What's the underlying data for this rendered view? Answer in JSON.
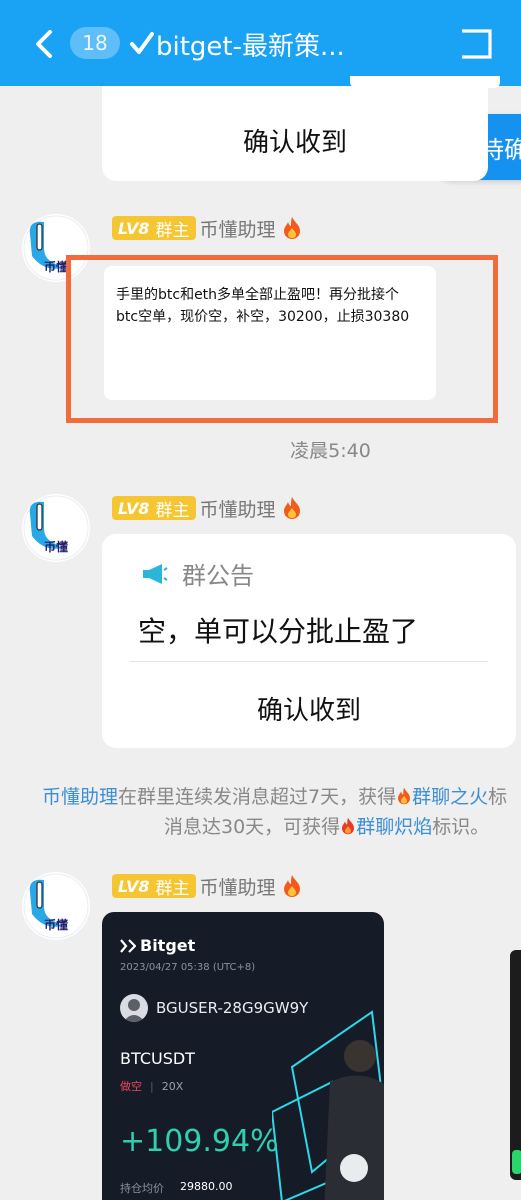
{
  "header": {
    "unread_count": "18",
    "title": "bitget-最新策..."
  },
  "floating": {
    "pending_label": "待确"
  },
  "top_card": {
    "confirm_label": "确认收到"
  },
  "messages": [
    {
      "level": "LV8",
      "role": "群主",
      "sender": "币懂助理",
      "text_line1": "手里的btc和eth多单全部止盈吧！再分批接个",
      "text_line2": "btc空单，现价空，补空，30200，止损30380"
    },
    {
      "level": "LV8",
      "role": "群主",
      "sender": "币懂助理",
      "notice_title": "群公告",
      "notice_body": "空，单可以分批止盈了",
      "confirm_label": "确认收到"
    },
    {
      "level": "LV8",
      "role": "群主",
      "sender": "币懂助理"
    }
  ],
  "timestamp": "凌晨5:40",
  "system_message": {
    "line1_name": "币懂助理",
    "line1_text": "在群里连续发消息超过7天，获得",
    "line1_award": "群聊之火",
    "line1_tail": "标",
    "line2_text": "消息达30天，可获得",
    "line2_award": "群聊炽焰",
    "line2_tail": "标识。"
  },
  "avatar_text": "币懂",
  "share_card": {
    "brand": "Bitget",
    "datetime": "2023/04/27 05:38 (UTC+8)",
    "username": "BGUSER-28G9GW9Y",
    "pair": "BTCUSDT",
    "side": "做空",
    "leverage": "20X",
    "pnl": "+109.94%",
    "entry_label": "持仓均价",
    "entry_value": "29880.00"
  },
  "colors": {
    "header_bg": "#1aa2f4",
    "highlight_border": "#f26c3b",
    "link": "#3b8fd6",
    "pnl": "#2fcfb0",
    "short": "#f0455a"
  }
}
